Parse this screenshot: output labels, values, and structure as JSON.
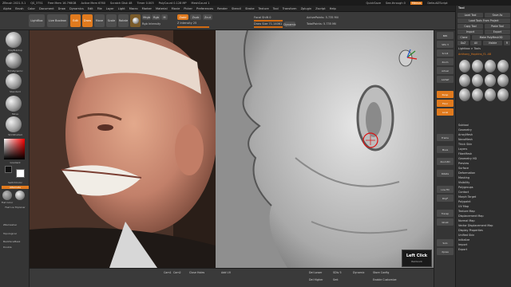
{
  "titlebar": {
    "items": [
      "ZBrush 2021.5.1",
      "QS_3751",
      "Free Mem 16.798GB",
      "Active Mem 6760",
      "Scratch Disk 48",
      "Timer 0.003",
      "PolyCount 0.128 MP",
      "MeshCount 1"
    ],
    "quicksave": "QuickSave",
    "see_through": "See-through 0",
    "menus_label": "Menus",
    "default_script": "DefaultZScript"
  },
  "menubar": {
    "items": [
      "Alpha",
      "Brush",
      "Color",
      "Document",
      "Draw",
      "Dynamics",
      "Edit",
      "File",
      "Layer",
      "Light",
      "Macro",
      "Marker",
      "Material",
      "Movie",
      "Picker",
      "Preferences",
      "Render",
      "Stencil",
      "Stroke",
      "Texture",
      "Tool",
      "Transform",
      "Zplugin",
      "Zscript",
      "Help"
    ]
  },
  "toolbar": {
    "lightbox": "LightBox",
    "live_boolean": "Live Boolean",
    "edit": "Edit",
    "draw": "Draw",
    "move": "Move",
    "scale": "Scale",
    "rotate": "Rotate",
    "mrgb": "Mrgb",
    "rgb": "Rgb",
    "m": "M",
    "rgb_intensity": "Rgb Intensity",
    "zadd": "Zadd",
    "zsub": "Zsub",
    "zcut": "Zcut",
    "z_intensity": "Z Intensity 25",
    "focal_shift": "Focal Shift 0",
    "draw_size": "Draw Size 71.14061",
    "dynamic": "Dynamic",
    "active_points": "ActivePoints: 5.735 Mil",
    "total_points": "TotalPoints: 5.735 Mil"
  },
  "left_shelf": {
    "items": [
      "ClayBuildup",
      "TrimDynamic",
      "Standard",
      "Move",
      "DragRect",
      "SkinShade4",
      "Gradient",
      "SwitchColor",
      "Alternate",
      "Flat Color",
      "Fast Lie Triplanar"
    ],
    "zremesher": "ZRemesher",
    "topological": "Topological",
    "backface_mask": "BackfaceMask",
    "double": "Double"
  },
  "right_shelf": {
    "items": [
      "BPR",
      "SPix 3",
      "Scroll",
      "Zoom",
      "Actual",
      "AAHalf",
      "Persp",
      "Floor",
      "Local",
      "Frame",
      "Move",
      "Zoom3D",
      "Rotate",
      "Line Fill",
      "PolyF",
      "Transp",
      "Ghost",
      "Solo",
      "Xpose"
    ]
  },
  "tray": {
    "header": "Tool",
    "buttons": [
      "Load Tool",
      "Save As",
      "Load Tools From Project",
      "Copy Tool",
      "Paste Tool",
      "Import",
      "Export",
      "Clone",
      "Make PolyMesh3D",
      "GoZ",
      "All",
      "Visible",
      "R"
    ],
    "lightbox_tools": "Lightbox > Tools",
    "tool_name": "Anthony_Hopkins_f1..48",
    "subtools": [
      "Subtool",
      "Geometry",
      "ArrayMesh",
      "NanoMesh",
      "Thick Skin",
      "Layers",
      "FiberMesh",
      "Geometry HD",
      "Preview",
      "Surface",
      "Deformation",
      "Masking",
      "Visibility",
      "Polygroups",
      "Contact",
      "Morph Target",
      "Polypaint",
      "UV Map",
      "Texture Map",
      "Displacement Map",
      "Normal Map",
      "Vector Displacement Map",
      "Display Properties",
      "Unified Skin",
      "Initialize",
      "Import",
      "Export"
    ]
  },
  "bottom": {
    "cam1": "Cam1",
    "cam2": "Cam2",
    "close_holes": "Close Holes",
    "add_uv": "Add UV",
    "sdiv": "SDiv",
    "dynamic_sub": "Dynamic",
    "smt": "Smt",
    "store_config": "Store Config",
    "enable_customize": "Enable Customize",
    "del_lower": "Del Lower",
    "del_higher": "Del Higher",
    "sdiv_value": "SDiv 5"
  },
  "overlay": {
    "left_click": "Left Click",
    "sub_label": "ItemLock"
  }
}
